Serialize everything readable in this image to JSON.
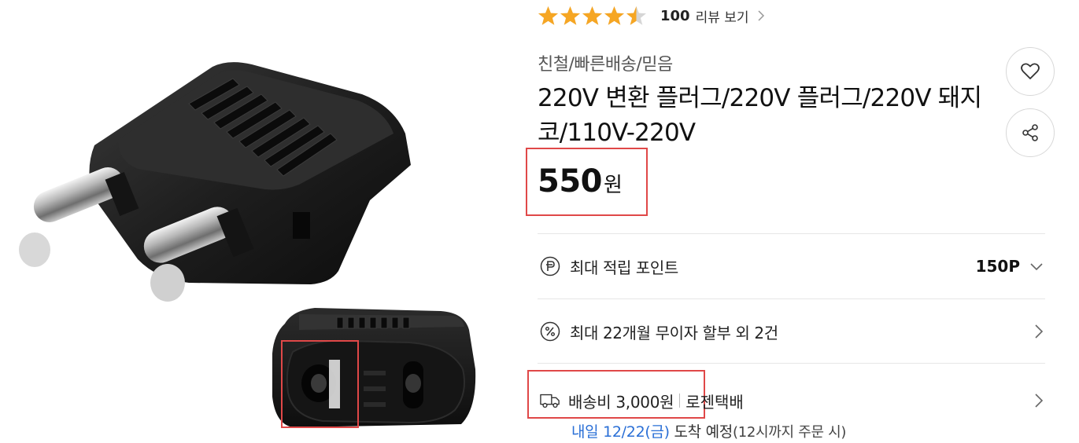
{
  "rating": {
    "stars_value": 4.5,
    "stars_max": 5,
    "star_color": "#f6a623",
    "review_count": "100",
    "review_link_label": "리뷰 보기"
  },
  "seller_tags": "친철/빠른배송/믿음",
  "product": {
    "title": "220V 변환 플러그/220V 플러그/220V 돼지코/110V-220V",
    "price_value": "550",
    "price_unit": "원"
  },
  "actions": {
    "like_icon": "heart-icon",
    "share_icon": "share-icon"
  },
  "benefits": {
    "points_label": "최대 적립 포인트",
    "points_value": "150P",
    "installment_label": "최대 22개월 무이자 할부 외 2건"
  },
  "shipping": {
    "fee_label": "배송비 3,000원",
    "courier": "로젠택배",
    "eta_date": "내일 12/22(금)",
    "eta_text": " 도착 예정",
    "eta_note": "(12시까지 주문 시)"
  },
  "colors": {
    "highlight": "#e04848",
    "link_blue": "#2a6fd6",
    "plug_body": "#1c1c1c"
  }
}
